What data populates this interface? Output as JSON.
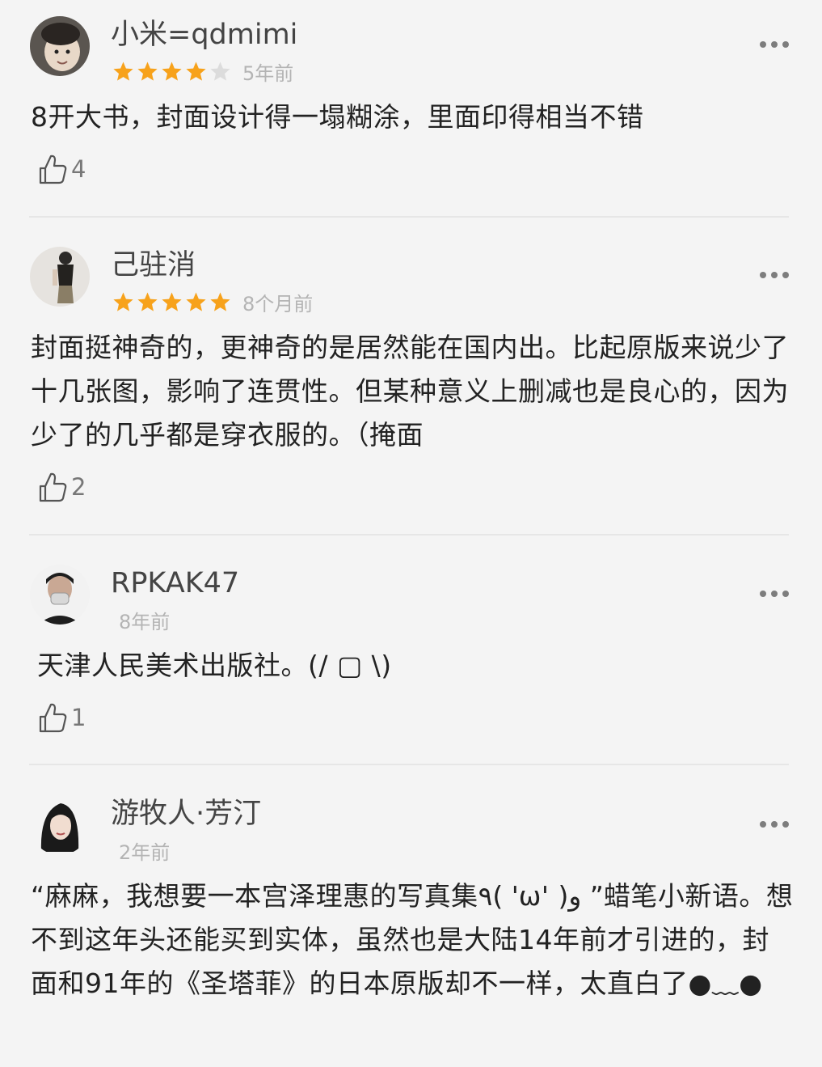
{
  "reviews": [
    {
      "username": "小米=qdmimi",
      "rating": 4,
      "max_rating": 5,
      "time": "5年前",
      "content": "8开大书，封面设计得一塌糊涂，里面印得相当不错",
      "likes": "4",
      "avatar_icon": "child-photo-avatar"
    },
    {
      "username": "己驻消",
      "rating": 5,
      "max_rating": 5,
      "time": "8个月前",
      "content": "封面挺神奇的，更神奇的是居然能在国内出。比起原版来说少了十几张图，影响了连贯性。但某种意义上删减也是良心的，因为少了的几乎都是穿衣服的。（掩面",
      "likes": "2",
      "avatar_icon": "person-standing-avatar"
    },
    {
      "username": "RPKAK47",
      "rating": null,
      "time": "8年前",
      "content": "天津人民美术出版社。(/ ▢ \\)",
      "likes": "1",
      "avatar_icon": "masked-man-avatar"
    },
    {
      "username": "游牧人·芳汀",
      "rating": null,
      "time": "2年前",
      "content": "“麻麻，我想要一本宫泽理惠的写真集٩( 'ω' )و ”蜡笔小新语。想不到这年头还能买到实体，虽然也是大陆14年前才引进的，封面和91年的《圣塔菲》的日本原版却不一样，太直白了●﹏●",
      "likes": "",
      "avatar_icon": "woman-portrait-avatar"
    }
  ],
  "colors": {
    "background": "#f4f4f4",
    "star_filled": "#f7a21b",
    "star_empty": "#dcdcdc",
    "meta_text": "#b4b4b4"
  },
  "icons": {
    "more": "more-dots-icon",
    "like": "thumbs-up-icon",
    "star": "star-icon"
  }
}
